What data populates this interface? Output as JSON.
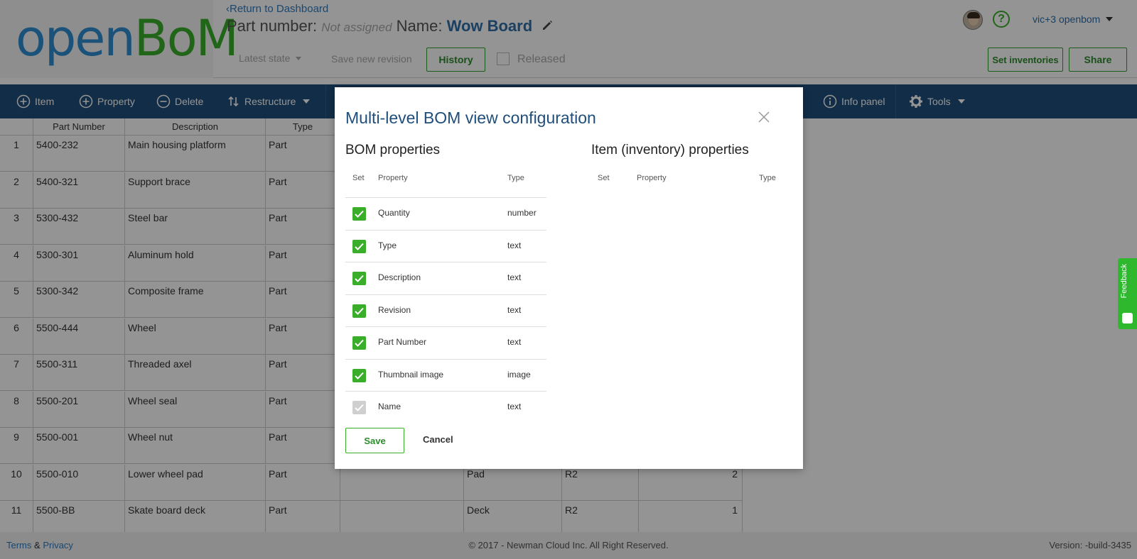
{
  "header": {
    "logo_part1": "open",
    "logo_part2": "BoM",
    "return_link": "Return to Dashboard",
    "part_number_label": "Part number:",
    "part_number_value": "Not assigned",
    "name_label": "Name:",
    "name_value": "Wow Board",
    "state_dropdown": "Latest state",
    "save_revision": "Save new revision",
    "history_button": "History",
    "released_label": "Released",
    "user_name": "vic+3 openbom",
    "set_inventories": "Set inventories",
    "share": "Share"
  },
  "toolbar": {
    "item": "Item",
    "property": "Property",
    "delete": "Delete",
    "restructure": "Restructure",
    "info_panel": "Info panel",
    "tools": "Tools"
  },
  "grid": {
    "headers": [
      "Part Number",
      "Description",
      "Type"
    ],
    "rows": [
      {
        "n": "1",
        "part": "5400-232",
        "desc": "Main housing platform",
        "type": "Part"
      },
      {
        "n": "2",
        "part": "5400-321",
        "desc": "Support brace",
        "type": "Part"
      },
      {
        "n": "3",
        "part": "5300-432",
        "desc": "Steel bar",
        "type": "Part"
      },
      {
        "n": "4",
        "part": "5300-301",
        "desc": "Aluminum hold",
        "type": "Part"
      },
      {
        "n": "5",
        "part": "5300-342",
        "desc": "Composite frame",
        "type": "Part"
      },
      {
        "n": "6",
        "part": "5500-444",
        "desc": "Wheel",
        "type": "Part"
      },
      {
        "n": "7",
        "part": "5500-311",
        "desc": "Threaded axel",
        "type": "Part"
      },
      {
        "n": "8",
        "part": "5500-201",
        "desc": "Wheel seal",
        "type": "Part"
      },
      {
        "n": "9",
        "part": "5500-001",
        "desc": "Wheel nut",
        "type": "Part"
      },
      {
        "n": "10",
        "part": "5500-010",
        "desc": "Lower wheel pad",
        "type": "Part",
        "name": "Pad",
        "rev": "R2",
        "qty": "2"
      },
      {
        "n": "11",
        "part": "5500-BB",
        "desc": "Skate board deck",
        "type": "Part",
        "name": "Deck",
        "rev": "R2",
        "qty": "1"
      }
    ]
  },
  "modal": {
    "title": "Multi-level BOM view configuration",
    "bom_section": "BOM properties",
    "item_section": "Item (inventory) properties",
    "col_set": "Set",
    "col_property": "Property",
    "col_type": "Type",
    "properties": [
      {
        "name": "Quantity",
        "type": "number",
        "enabled": true
      },
      {
        "name": "Type",
        "type": "text",
        "enabled": true
      },
      {
        "name": "Description",
        "type": "text",
        "enabled": true
      },
      {
        "name": "Revision",
        "type": "text",
        "enabled": true
      },
      {
        "name": "Part Number",
        "type": "text",
        "enabled": true
      },
      {
        "name": "Thumbnail image",
        "type": "image",
        "enabled": true
      },
      {
        "name": "Name",
        "type": "text",
        "enabled": false
      }
    ],
    "save": "Save",
    "cancel": "Cancel"
  },
  "footer": {
    "terms": "Terms",
    "amp": "&",
    "privacy": "Privacy",
    "copyright": "© 2017 - Newman Cloud Inc. All Right Reserved.",
    "version": "Version: -build-3435"
  },
  "feedback": "Feedback",
  "colors": {
    "brand_blue": "#2f8ed2",
    "brand_green": "#3aae2a",
    "toolbar": "#1f4e7a"
  }
}
